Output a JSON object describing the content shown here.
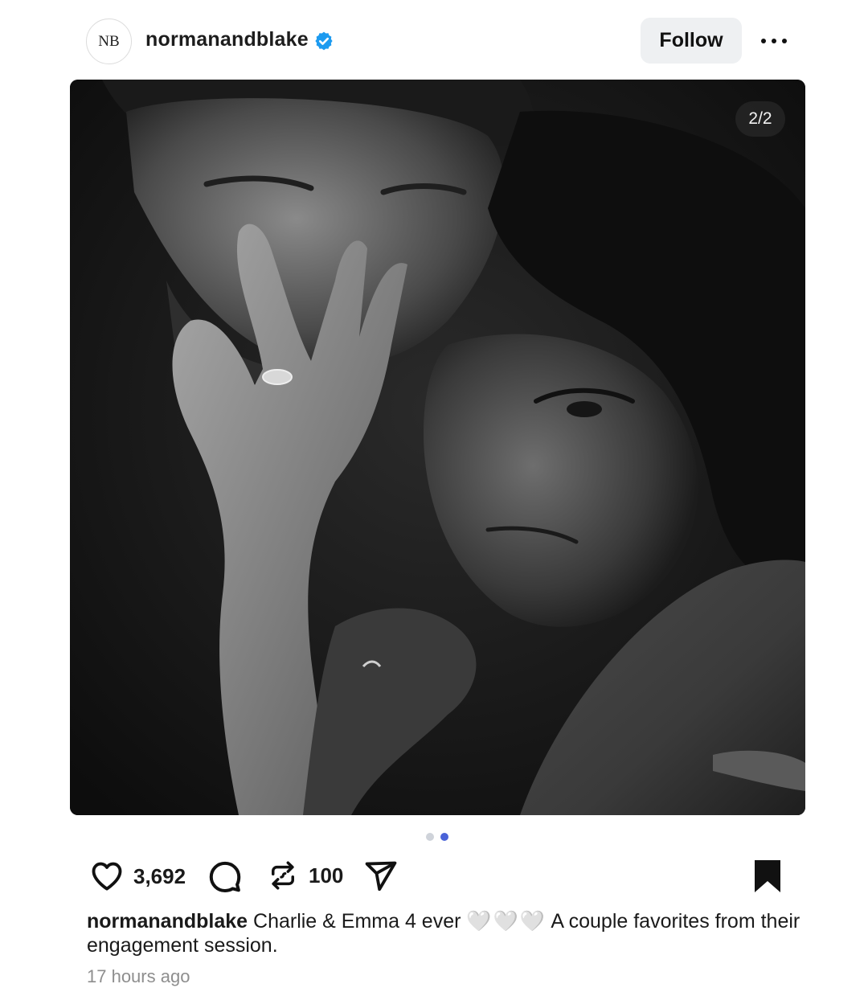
{
  "post": {
    "avatar_initials": "NB",
    "username": "normanandblake",
    "verified": true,
    "follow_label": "Follow",
    "slide_counter": "2/2",
    "carousel": {
      "total": 2,
      "active": 2
    },
    "likes": "3,692",
    "reposts": "100",
    "caption_user": "normanandblake",
    "caption_text": "Charlie & Emma 4 ever",
    "caption_hearts": "🤍🤍🤍",
    "caption_rest": "A couple favorites from their engagement session.",
    "timestamp": "17 hours ago"
  },
  "icons": {
    "verified": "verified-badge-icon",
    "more": "more-options-icon",
    "like": "heart-icon",
    "comment": "comment-icon",
    "repost": "repost-icon",
    "share": "share-icon",
    "save": "bookmark-icon"
  },
  "colors": {
    "verified_blue": "#1d9bf0",
    "active_dot": "#4a63d8",
    "follow_bg": "#eef0f2"
  }
}
